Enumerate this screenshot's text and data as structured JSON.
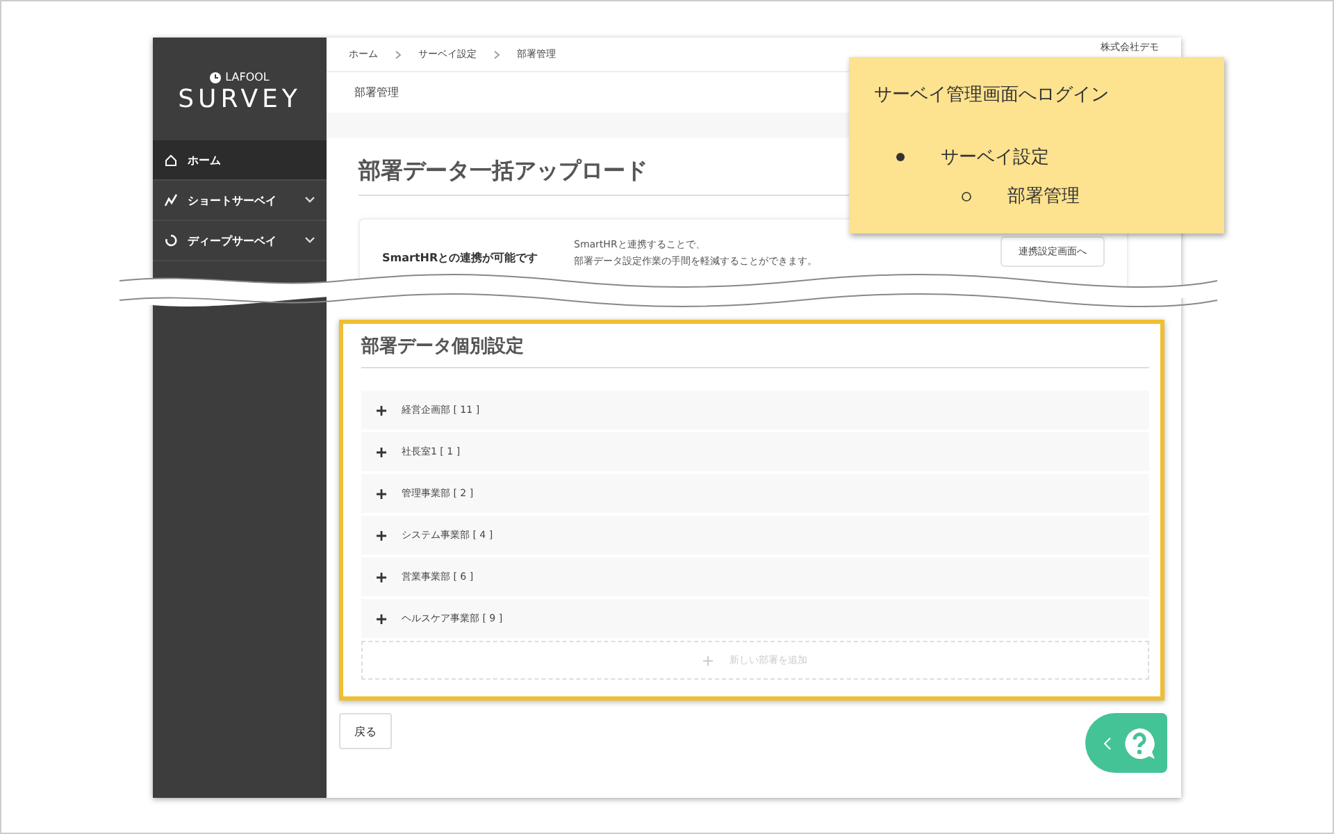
{
  "breadcrumb": [
    "ホーム",
    "サーベイ設定",
    "部署管理"
  ],
  "account": {
    "label": "株式会社デモ"
  },
  "page_title": "部署管理",
  "sidebar": {
    "logo_small": "LAFOOL",
    "logo": "SURVEY",
    "items": [
      {
        "label": "ホーム",
        "kind": "home",
        "selected": true,
        "expandable": false
      },
      {
        "label": "ショートサーベイ",
        "kind": "short",
        "selected": false,
        "expandable": true
      },
      {
        "label": "ディープサーベイ",
        "kind": "deep",
        "selected": false,
        "expandable": true
      }
    ]
  },
  "upload_section": {
    "heading": "部署データ一括アップロード",
    "card": {
      "label": "SmartHRとの連携が可能です",
      "description": [
        "SmartHRと連携することで、",
        "部署データ設定作業の手間を軽減することができます。"
      ],
      "button": "連携設定画面へ"
    }
  },
  "department_section": {
    "heading": "部署データ個別設定",
    "departments": [
      {
        "label": "経営企画部 [ 11 ]",
        "expanded": false
      },
      {
        "label": "社長室1 [ 1 ]",
        "expanded": false
      },
      {
        "label": "管理事業部 [ 2 ]",
        "expanded": false
      },
      {
        "label": "システム事業部 [ 4 ]",
        "expanded": false
      },
      {
        "label": "営業事業部 [ 6 ]",
        "expanded": false
      },
      {
        "label": "ヘルスケア事業部 [ 9 ]",
        "expanded": false
      }
    ],
    "add_button": {
      "label": "新しい部署を追加",
      "disabled": true
    }
  },
  "back_button": "戻る",
  "annotation": {
    "title": "サーベイ管理画面へログイン",
    "items": [
      {
        "text": "サーベイ設定",
        "children": [
          {
            "text": "部署管理"
          }
        ]
      }
    ]
  }
}
